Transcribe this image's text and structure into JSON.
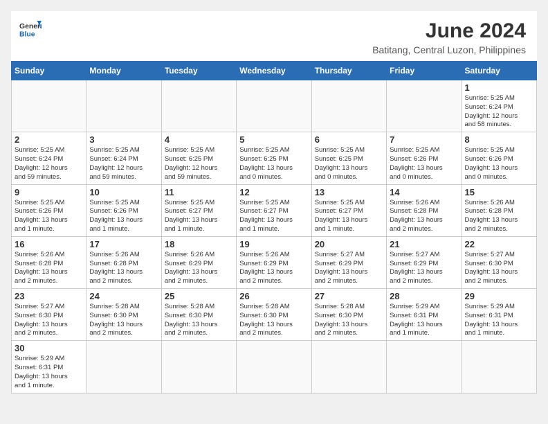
{
  "header": {
    "logo_general": "General",
    "logo_blue": "Blue",
    "month_year": "June 2024",
    "location": "Batitang, Central Luzon, Philippines"
  },
  "weekdays": [
    "Sunday",
    "Monday",
    "Tuesday",
    "Wednesday",
    "Thursday",
    "Friday",
    "Saturday"
  ],
  "weeks": [
    [
      {
        "day": "",
        "info": ""
      },
      {
        "day": "",
        "info": ""
      },
      {
        "day": "",
        "info": ""
      },
      {
        "day": "",
        "info": ""
      },
      {
        "day": "",
        "info": ""
      },
      {
        "day": "",
        "info": ""
      },
      {
        "day": "1",
        "info": "Sunrise: 5:25 AM\nSunset: 6:24 PM\nDaylight: 12 hours\nand 58 minutes."
      }
    ],
    [
      {
        "day": "2",
        "info": "Sunrise: 5:25 AM\nSunset: 6:24 PM\nDaylight: 12 hours\nand 59 minutes."
      },
      {
        "day": "3",
        "info": "Sunrise: 5:25 AM\nSunset: 6:24 PM\nDaylight: 12 hours\nand 59 minutes."
      },
      {
        "day": "4",
        "info": "Sunrise: 5:25 AM\nSunset: 6:25 PM\nDaylight: 12 hours\nand 59 minutes."
      },
      {
        "day": "5",
        "info": "Sunrise: 5:25 AM\nSunset: 6:25 PM\nDaylight: 13 hours\nand 0 minutes."
      },
      {
        "day": "6",
        "info": "Sunrise: 5:25 AM\nSunset: 6:25 PM\nDaylight: 13 hours\nand 0 minutes."
      },
      {
        "day": "7",
        "info": "Sunrise: 5:25 AM\nSunset: 6:26 PM\nDaylight: 13 hours\nand 0 minutes."
      },
      {
        "day": "8",
        "info": "Sunrise: 5:25 AM\nSunset: 6:26 PM\nDaylight: 13 hours\nand 0 minutes."
      }
    ],
    [
      {
        "day": "9",
        "info": "Sunrise: 5:25 AM\nSunset: 6:26 PM\nDaylight: 13 hours\nand 1 minute."
      },
      {
        "day": "10",
        "info": "Sunrise: 5:25 AM\nSunset: 6:26 PM\nDaylight: 13 hours\nand 1 minute."
      },
      {
        "day": "11",
        "info": "Sunrise: 5:25 AM\nSunset: 6:27 PM\nDaylight: 13 hours\nand 1 minute."
      },
      {
        "day": "12",
        "info": "Sunrise: 5:25 AM\nSunset: 6:27 PM\nDaylight: 13 hours\nand 1 minute."
      },
      {
        "day": "13",
        "info": "Sunrise: 5:25 AM\nSunset: 6:27 PM\nDaylight: 13 hours\nand 1 minute."
      },
      {
        "day": "14",
        "info": "Sunrise: 5:26 AM\nSunset: 6:28 PM\nDaylight: 13 hours\nand 2 minutes."
      },
      {
        "day": "15",
        "info": "Sunrise: 5:26 AM\nSunset: 6:28 PM\nDaylight: 13 hours\nand 2 minutes."
      }
    ],
    [
      {
        "day": "16",
        "info": "Sunrise: 5:26 AM\nSunset: 6:28 PM\nDaylight: 13 hours\nand 2 minutes."
      },
      {
        "day": "17",
        "info": "Sunrise: 5:26 AM\nSunset: 6:28 PM\nDaylight: 13 hours\nand 2 minutes."
      },
      {
        "day": "18",
        "info": "Sunrise: 5:26 AM\nSunset: 6:29 PM\nDaylight: 13 hours\nand 2 minutes."
      },
      {
        "day": "19",
        "info": "Sunrise: 5:26 AM\nSunset: 6:29 PM\nDaylight: 13 hours\nand 2 minutes."
      },
      {
        "day": "20",
        "info": "Sunrise: 5:27 AM\nSunset: 6:29 PM\nDaylight: 13 hours\nand 2 minutes."
      },
      {
        "day": "21",
        "info": "Sunrise: 5:27 AM\nSunset: 6:29 PM\nDaylight: 13 hours\nand 2 minutes."
      },
      {
        "day": "22",
        "info": "Sunrise: 5:27 AM\nSunset: 6:30 PM\nDaylight: 13 hours\nand 2 minutes."
      }
    ],
    [
      {
        "day": "23",
        "info": "Sunrise: 5:27 AM\nSunset: 6:30 PM\nDaylight: 13 hours\nand 2 minutes."
      },
      {
        "day": "24",
        "info": "Sunrise: 5:28 AM\nSunset: 6:30 PM\nDaylight: 13 hours\nand 2 minutes."
      },
      {
        "day": "25",
        "info": "Sunrise: 5:28 AM\nSunset: 6:30 PM\nDaylight: 13 hours\nand 2 minutes."
      },
      {
        "day": "26",
        "info": "Sunrise: 5:28 AM\nSunset: 6:30 PM\nDaylight: 13 hours\nand 2 minutes."
      },
      {
        "day": "27",
        "info": "Sunrise: 5:28 AM\nSunset: 6:30 PM\nDaylight: 13 hours\nand 2 minutes."
      },
      {
        "day": "28",
        "info": "Sunrise: 5:29 AM\nSunset: 6:31 PM\nDaylight: 13 hours\nand 1 minute."
      },
      {
        "day": "29",
        "info": "Sunrise: 5:29 AM\nSunset: 6:31 PM\nDaylight: 13 hours\nand 1 minute."
      }
    ],
    [
      {
        "day": "30",
        "info": "Sunrise: 5:29 AM\nSunset: 6:31 PM\nDaylight: 13 hours\nand 1 minute."
      },
      {
        "day": "",
        "info": ""
      },
      {
        "day": "",
        "info": ""
      },
      {
        "day": "",
        "info": ""
      },
      {
        "day": "",
        "info": ""
      },
      {
        "day": "",
        "info": ""
      },
      {
        "day": "",
        "info": ""
      }
    ]
  ]
}
